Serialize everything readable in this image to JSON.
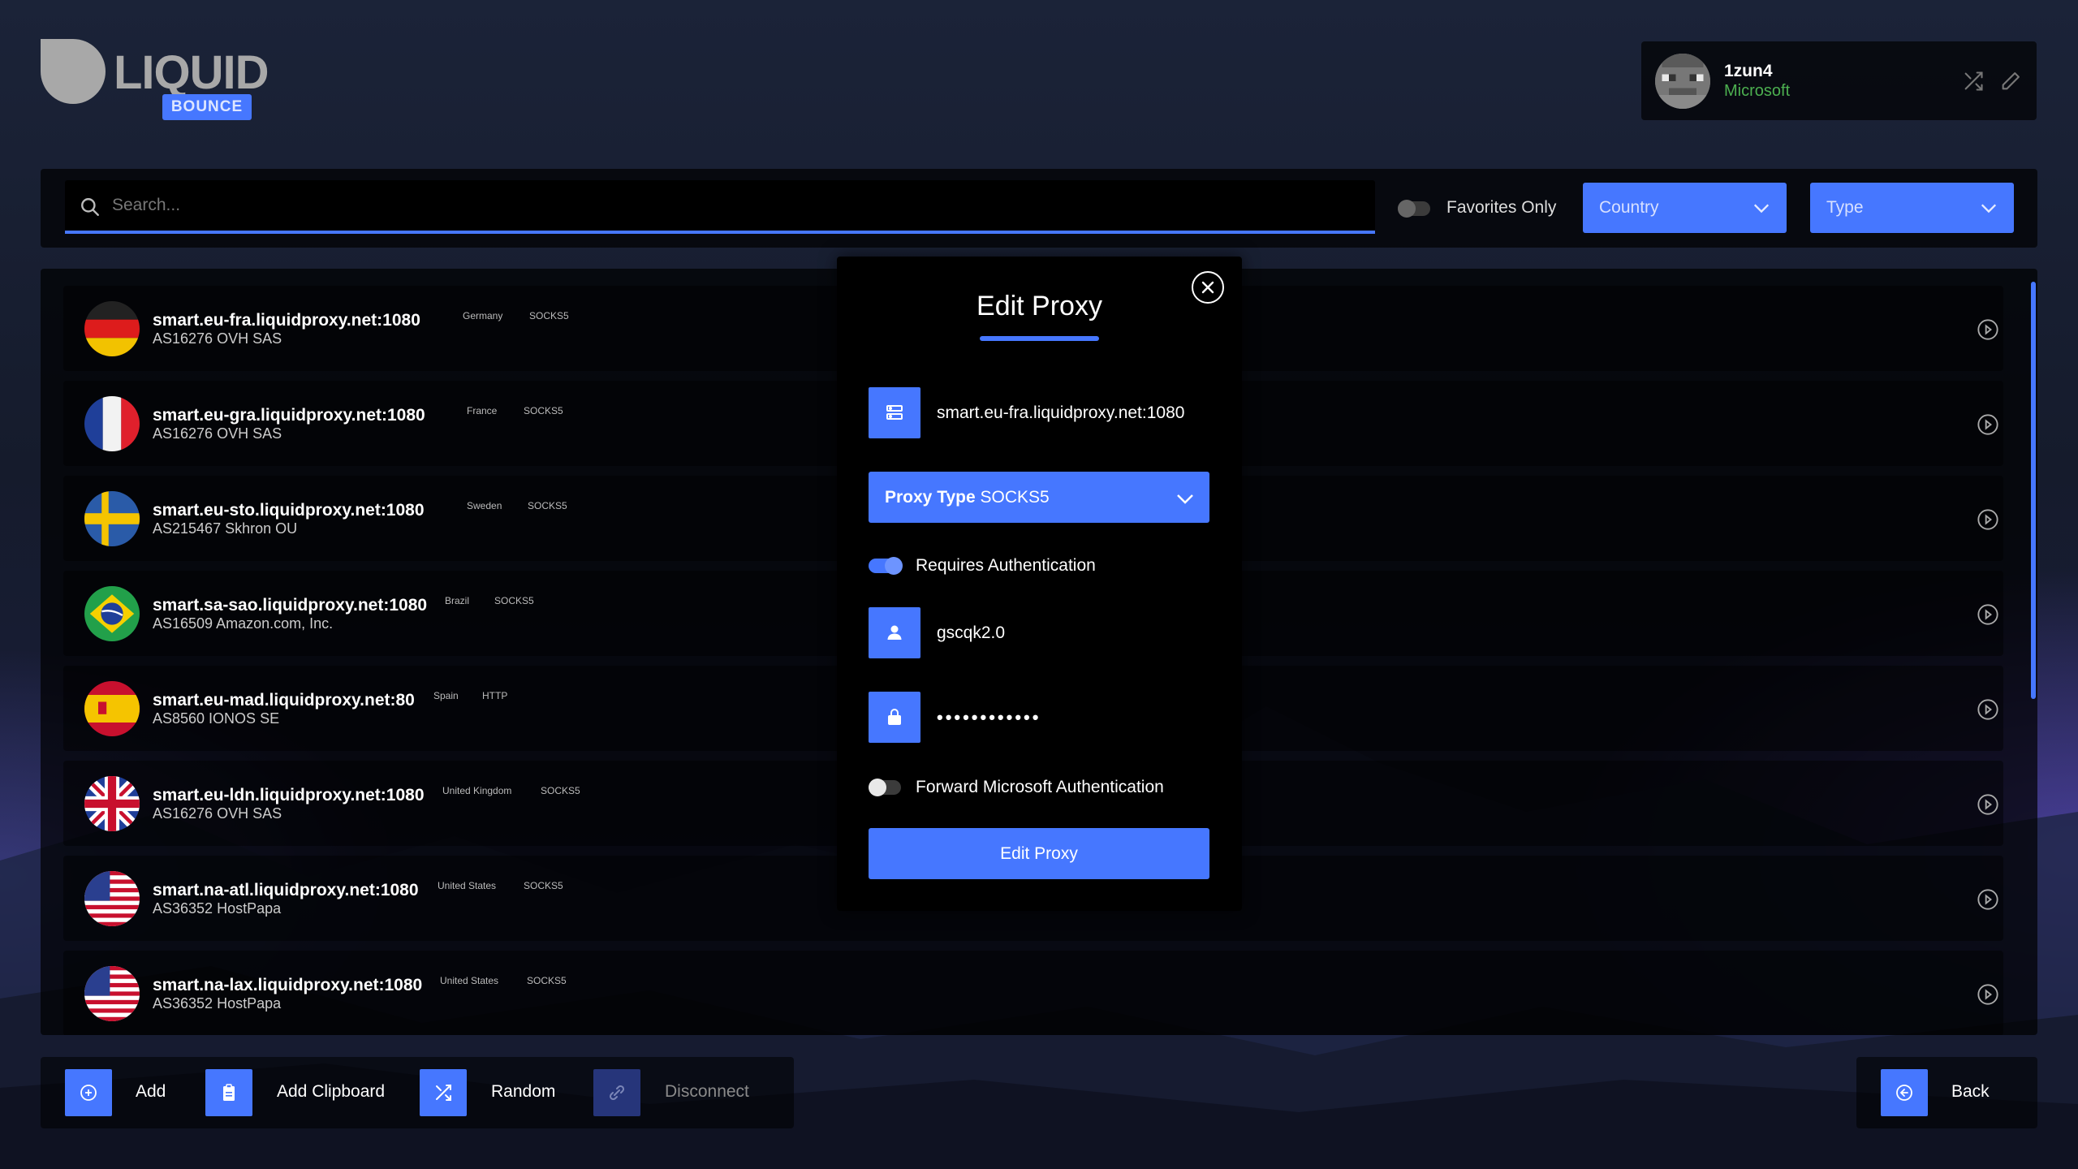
{
  "logo": {
    "text": "LIQUID",
    "badge": "BOUNCE"
  },
  "account": {
    "username": "1zun4",
    "type": "Microsoft"
  },
  "filter": {
    "search_placeholder": "Search...",
    "favorites_label": "Favorites Only",
    "country_label": "Country",
    "type_label": "Type"
  },
  "proxies": [
    {
      "host": "smart.eu-fra.liquidproxy.net:1080",
      "asn": "AS16276 OVH SAS",
      "country": "Germany",
      "type": "SOCKS5",
      "flag": "de"
    },
    {
      "host": "smart.eu-gra.liquidproxy.net:1080",
      "asn": "AS16276 OVH SAS",
      "country": "France",
      "type": "SOCKS5",
      "flag": "fr"
    },
    {
      "host": "smart.eu-sto.liquidproxy.net:1080",
      "asn": "AS215467 Skhron OU",
      "country": "Sweden",
      "type": "SOCKS5",
      "flag": "se"
    },
    {
      "host": "smart.sa-sao.liquidproxy.net:1080",
      "asn": "AS16509 Amazon.com, Inc.",
      "country": "Brazil",
      "type": "SOCKS5",
      "flag": "br"
    },
    {
      "host": "smart.eu-mad.liquidproxy.net:80",
      "asn": "AS8560 IONOS SE",
      "country": "Spain",
      "type": "HTTP",
      "flag": "es"
    },
    {
      "host": "smart.eu-ldn.liquidproxy.net:1080",
      "asn": "AS16276 OVH SAS",
      "country": "United Kingdom",
      "type": "SOCKS5",
      "flag": "gb"
    },
    {
      "host": "smart.na-atl.liquidproxy.net:1080",
      "asn": "AS36352 HostPapa",
      "country": "United States",
      "type": "SOCKS5",
      "flag": "us"
    },
    {
      "host": "smart.na-lax.liquidproxy.net:1080",
      "asn": "AS36352 HostPapa",
      "country": "United States",
      "type": "SOCKS5",
      "flag": "us"
    }
  ],
  "modal": {
    "title": "Edit Proxy",
    "host_value": "smart.eu-fra.liquidproxy.net:1080",
    "proxy_type_label": "Proxy Type",
    "proxy_type_value": "SOCKS5",
    "requires_auth_label": "Requires Authentication",
    "requires_auth": true,
    "username_value": "gscqk2.0",
    "password_value": "••••••••••••",
    "forward_ms_label": "Forward Microsoft Authentication",
    "forward_ms": false,
    "submit_label": "Edit Proxy"
  },
  "bottom": {
    "add_label": "Add",
    "add_clipboard_label": "Add Clipboard",
    "random_label": "Random",
    "disconnect_label": "Disconnect",
    "back_label": "Back"
  },
  "colors": {
    "accent": "#4677ff",
    "microsoft": "#4caf50",
    "panel": "#000000"
  }
}
